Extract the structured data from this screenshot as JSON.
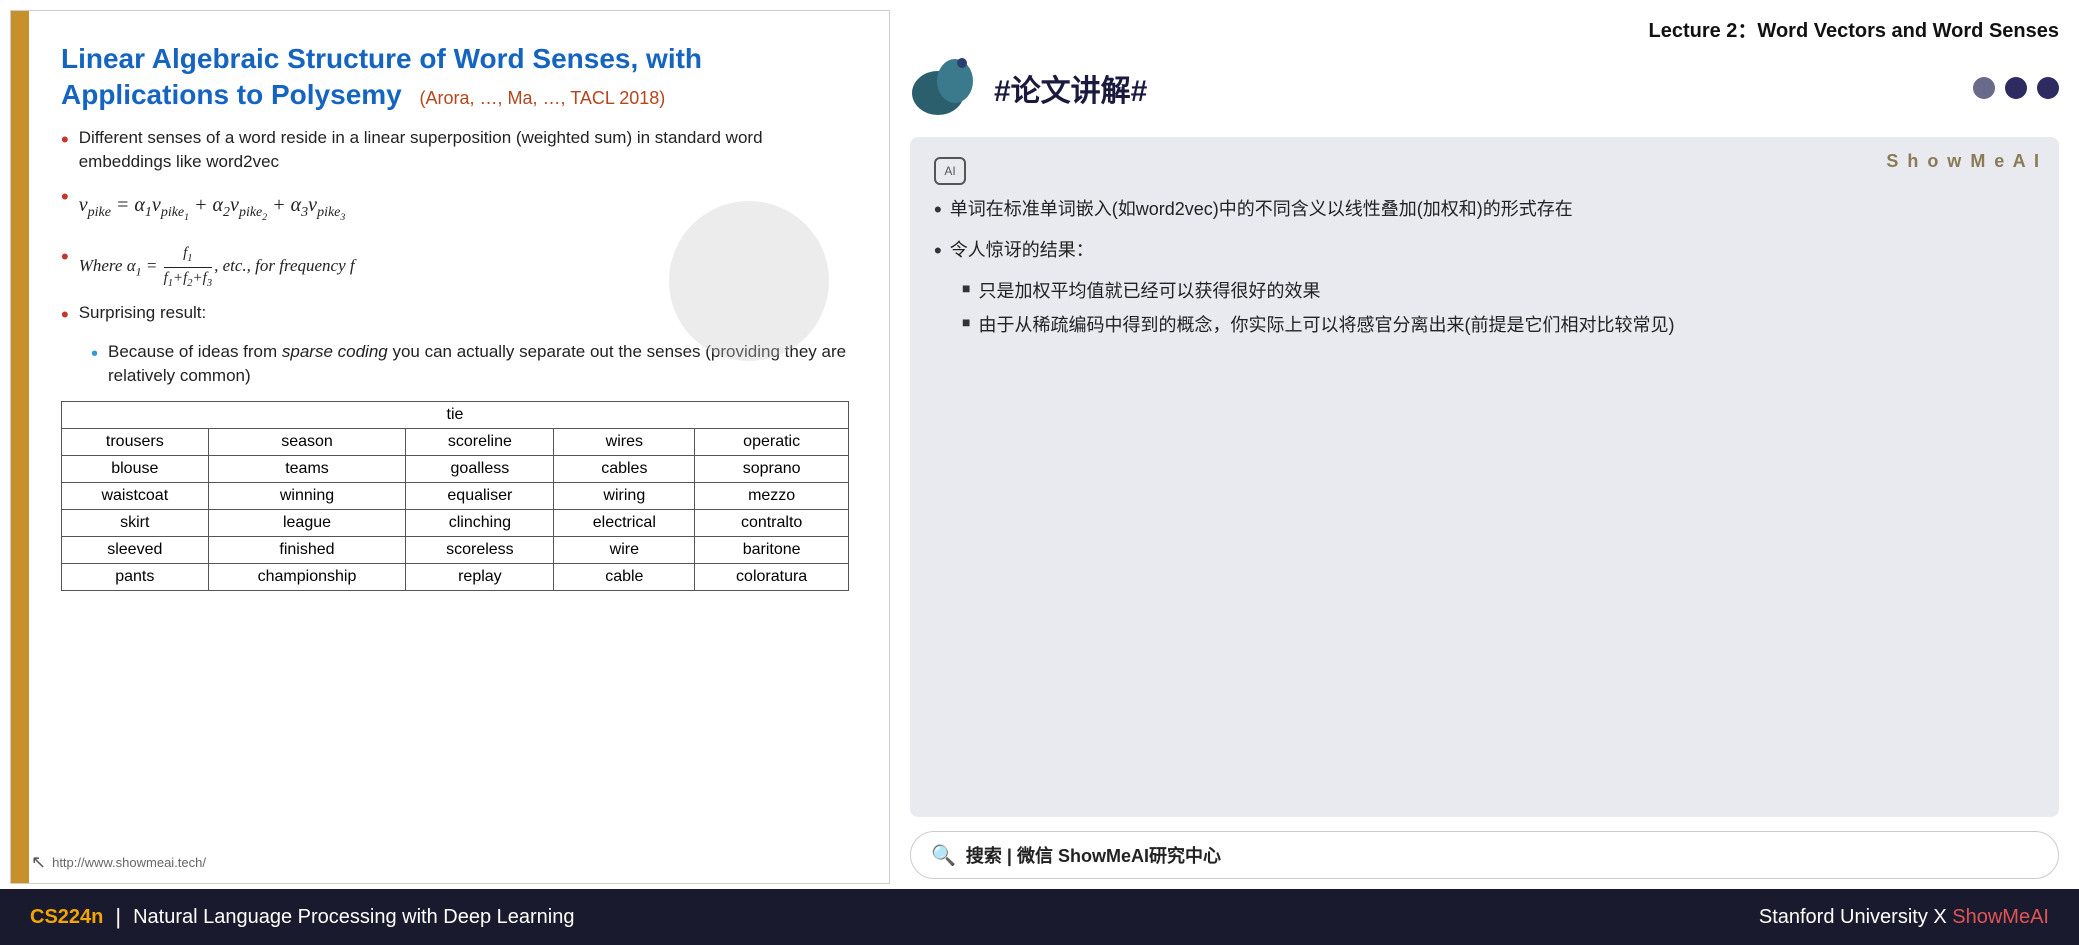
{
  "lecture": {
    "title": "Lecture 2：Word Vectors and Word Senses"
  },
  "slide": {
    "title": "Linear Algebraic Structure of Word Senses, with Applications to Polysemy",
    "reference": "(Arora, …, Ma, …, TACL 2018)",
    "bullets": [
      {
        "text": "Different senses of a word reside in a linear superposition (weighted sum) in standard word embeddings like word2vec"
      },
      {
        "formula": true,
        "text": "v_pike = α₁v_pike₁ + α₂v_pike₂ + α₃v_pike₃"
      },
      {
        "formula": true,
        "text": "Where α₁ = f₁/(f₁+f₂+f₃), etc., for frequency f"
      },
      {
        "text": "Surprising result:"
      }
    ],
    "sub_bullet": "Because of ideas from sparse coding you can actually separate out the senses (providing they are relatively common)",
    "table": {
      "header": "tie",
      "columns": [
        [
          "trousers",
          "blouse",
          "waistcoat",
          "skirt",
          "sleeved",
          "pants"
        ],
        [
          "season",
          "teams",
          "winning",
          "league",
          "finished",
          "championship"
        ],
        [
          "scoreline",
          "goalless",
          "equaliser",
          "clinching",
          "scoreless",
          "replay"
        ],
        [
          "wires",
          "cables",
          "wiring",
          "electrical",
          "wire",
          "cable"
        ],
        [
          "operatic",
          "soprano",
          "mezzo",
          "contralto",
          "baritone",
          "coloratura"
        ]
      ]
    },
    "watermark": {
      "url": "http://www.showmeai.tech/"
    }
  },
  "right_panel": {
    "topic": "#论文讲解#",
    "nav_dots": [
      "inactive",
      "active",
      "active"
    ],
    "showmeai_label": "S h o w M e A I",
    "ai_icon": "AI",
    "cn_content": {
      "bullet1": "单词在标准单词嵌入(如word2vec)中的不同含义以线性叠加(加权和)的形式存在",
      "bullet2": "令人惊讶的结果：",
      "sub1": "只是加权平均值就已经可以获得很好的效果",
      "sub2": "由于从稀疏编码中得到的概念，你实际上可以将感官分离出来(前提是它们相对比较常见)"
    },
    "search": {
      "icon": "🔍",
      "divider": "|",
      "text": "搜索 | 微信 ShowMeAI研究中心"
    }
  },
  "footer": {
    "cs_label": "CS224n",
    "divider": "|",
    "description": "Natural Language Processing with Deep Learning",
    "right": "Stanford University X ShowMeAI"
  }
}
